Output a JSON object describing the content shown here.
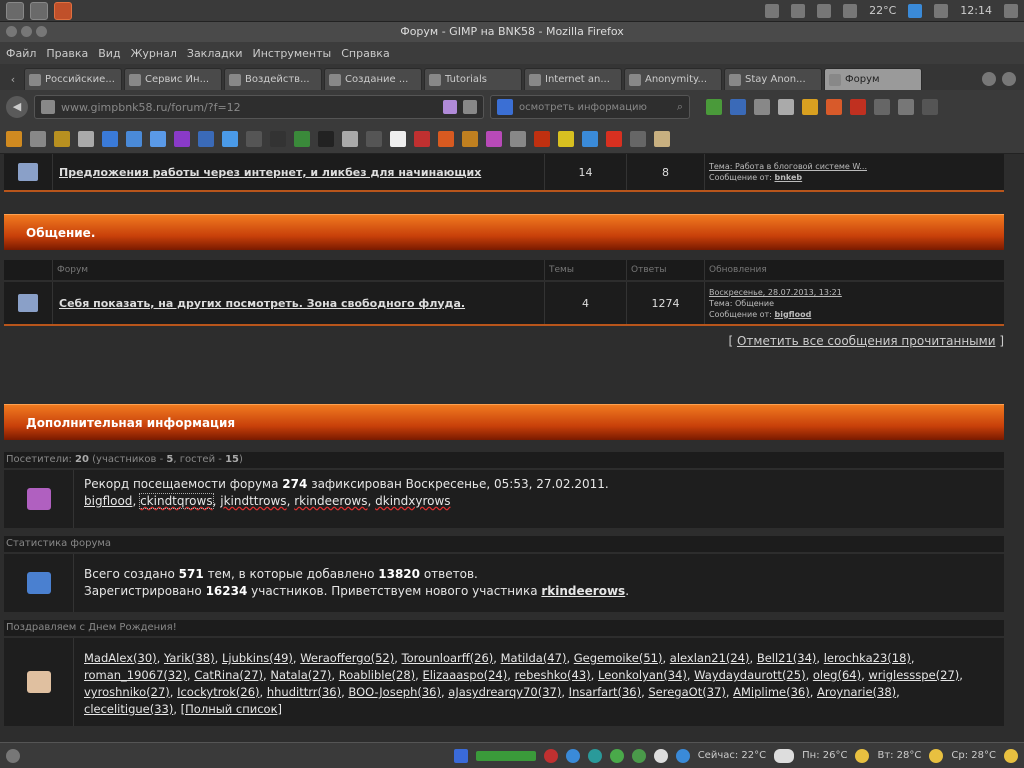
{
  "system": {
    "temperature": "22°C",
    "clock": "12:14"
  },
  "window": {
    "title": "Форум - GIMP на BNK58 - Mozilla Firefox"
  },
  "menu": [
    "Файл",
    "Правка",
    "Вид",
    "Журнал",
    "Закладки",
    "Инструменты",
    "Справка"
  ],
  "tabs": [
    {
      "label": "Российские..."
    },
    {
      "label": "Сервис Ин..."
    },
    {
      "label": "Воздейств..."
    },
    {
      "label": "Создание ..."
    },
    {
      "label": "Tutorials"
    },
    {
      "label": "Internet an..."
    },
    {
      "label": "Anonymity..."
    },
    {
      "label": "Stay Anon..."
    },
    {
      "label": "Форум",
      "active": true
    }
  ],
  "nav": {
    "url": "www.gimpbnk58.ru/forum/?f=12",
    "search_placeholder": "осмотреть информацию"
  },
  "forum_rows": [
    {
      "title": "Предложения работы через интернет, и ликбез для начинающих",
      "topics": "14",
      "posts": "8",
      "last_line1": "Тема: Работа в блоговой системе W...",
      "last_line2_label": "Сообщение от:",
      "last_line2_user": "bnkeb"
    }
  ],
  "sections": {
    "communication": "Общение.",
    "additional": "Дополнительная информация"
  },
  "columns": {
    "forum": "Форум",
    "topics": "Темы",
    "posts": "Ответы",
    "updates": "Обновления"
  },
  "communication_row": {
    "title": "Себя показать, на других посмотреть. Зона свободного флуда.",
    "topics": "4",
    "posts": "1274",
    "last_line1": "Воскресенье, 28.07.2013, 13:21",
    "last_line2": "Тема: Общение",
    "last_line3_label": "Сообщение от:",
    "last_line3_user": "bigflood"
  },
  "mark_all_read": "Отметить все сообщения прочитанными",
  "visitors": {
    "label": "Посетители:",
    "total": "20",
    "members_label": "(участников -",
    "members": "5",
    "guests_label": ", гостей -",
    "guests": "15",
    "close": ")"
  },
  "record": {
    "prefix": "Рекорд посещаемости форума",
    "count": "274",
    "suffix": "зафиксирован Воскресенье, 05:53, 27.02.2011.",
    "users": [
      "bigflood",
      "ckindtqrows",
      "jkindttrows",
      "rkindeerows",
      "dkindxyrows"
    ]
  },
  "stats": {
    "label": "Статистика форума",
    "line1_prefix": "Всего создано",
    "topics": "571",
    "line1_mid": "тем, в которые добавлено",
    "posts": "13820",
    "line1_suffix": "ответов.",
    "line2_prefix": "Зарегистрировано",
    "members": "16234",
    "line2_mid": "участников. Приветствуем нового участника",
    "newest": "rkindeerows",
    "line2_suffix": "."
  },
  "birthdays": {
    "label": "Поздравляем с Днем Рождения!",
    "users": [
      "MadAlex(30)",
      "Yarik(38)",
      "Ljubkins(49)",
      "Weraoffergo(52)",
      "Torounloarff(26)",
      "Matilda(47)",
      "Gegemoike(51)",
      "alexlan21(24)",
      "Bell21(34)",
      "lerochka23(18)",
      "roman_19067(32)",
      "CatRina(27)",
      "Natala(27)",
      "Roablible(28)",
      "Elizaaaspo(24)",
      "rebeshko(43)",
      "Leonkolyan(34)",
      "Waydaydaurott(25)",
      "oleg(64)",
      "wriglessspe(27)",
      "vyroshniko(27)",
      "Icockytrok(26)",
      "hhudittrr(36)",
      "BOO-Joseph(36)",
      "aJasydrearqy70(37)",
      "Insarfart(36)",
      "SeregaOt(37)",
      "AMiplime(36)",
      "Aroynarie(38)",
      "clecelitigue(33)"
    ],
    "full_list": "[Полный список]"
  },
  "taskbar": {
    "weather_now": "Сейчас: 22°C",
    "day1": "Пн: 26°C",
    "day2": "Вт: 28°C",
    "day3": "Ср: 28°C"
  }
}
